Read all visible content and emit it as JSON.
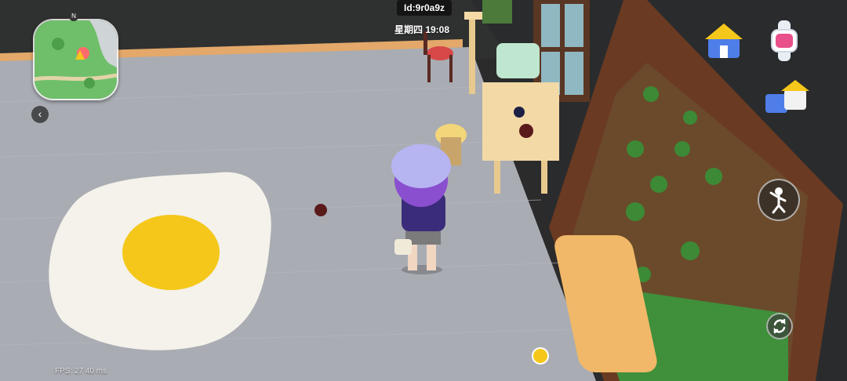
{
  "hud": {
    "player_id": "Id:9r0a9z",
    "day_time": "星期四 19:08",
    "fps": "FPS: 27 40 ms",
    "compass": "N"
  },
  "buttons": {
    "house": "house-icon",
    "watch": "smartwatch-icon",
    "furniture_shop": "furniture-shop-icon",
    "emote": "dance-figure-icon",
    "swap": "swap-arrows-icon",
    "back": "chevron-left-icon"
  },
  "colors": {
    "floor": "#a9acb3",
    "wall_trim": "#e3a86a",
    "egg_white": "#f4f2ea",
    "egg_yolk": "#f5c71a",
    "hat": "#b7b4f2",
    "hair": "#8a4fcf",
    "garden_soil": "#6b4a2b",
    "door_frame": "#6a3a22"
  }
}
